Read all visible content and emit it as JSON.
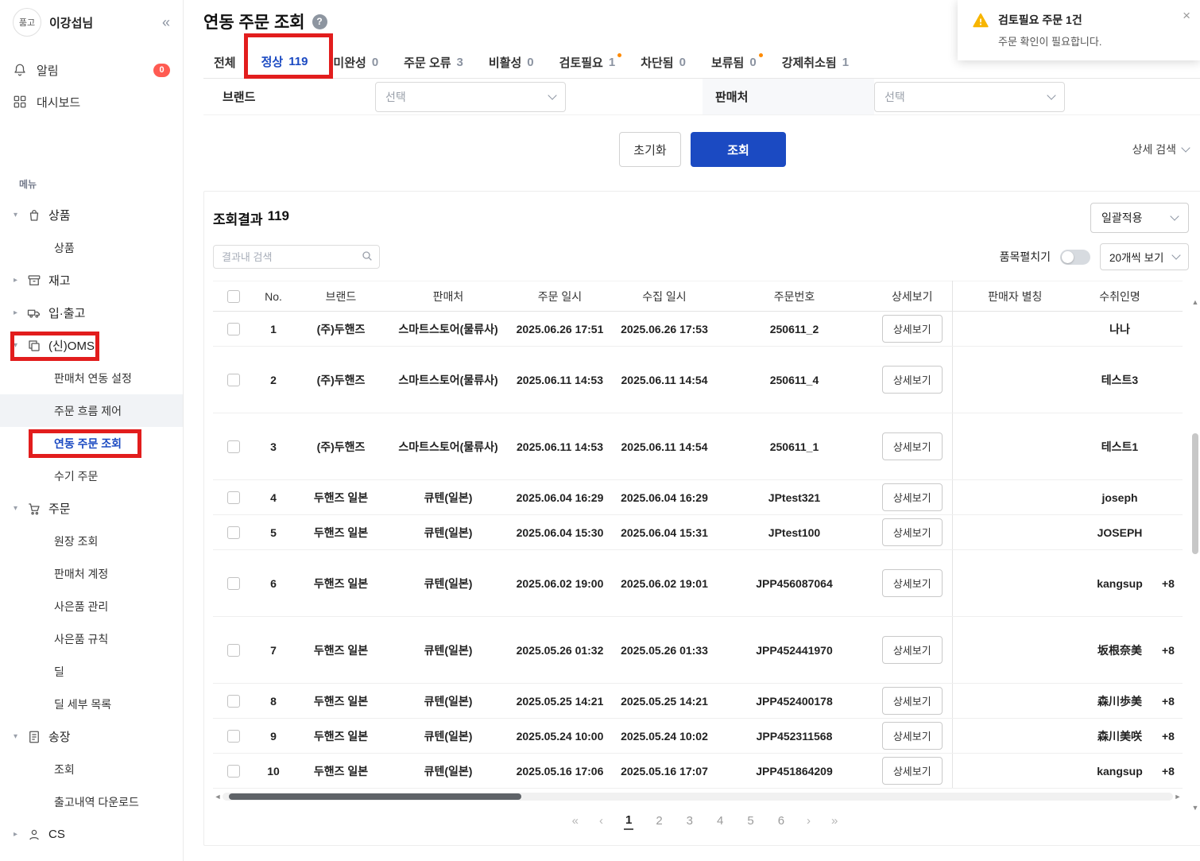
{
  "colors": {
    "accent_blue": "#1b4ac2",
    "annotation_red": "#e21d1d",
    "warning_yellow": "#f7b500",
    "badge_red": "#ff5b52",
    "dot_orange": "#ff8a00"
  },
  "sidebar": {
    "logo": "품고",
    "user_name": "이강섭님",
    "collapse": "«",
    "notifications": {
      "label": "알림",
      "badge": "0"
    },
    "dashboard": {
      "label": "대시보드"
    },
    "menu_heading": "메뉴",
    "groups": [
      {
        "label": "상품",
        "icon": "bag-icon",
        "expanded": true,
        "children": [
          {
            "label": "상품"
          }
        ]
      },
      {
        "label": "재고",
        "icon": "archive-icon",
        "expanded": false,
        "children": []
      },
      {
        "label": "입·출고",
        "icon": "truck-icon",
        "expanded": false,
        "children": []
      },
      {
        "label": "(신)OMS",
        "icon": "pages-icon",
        "expanded": true,
        "annotated": true,
        "children": [
          {
            "label": "판매처 연동 설정"
          },
          {
            "label": "주문 흐름 제어",
            "highlight": true
          },
          {
            "label": "연동 주문 조회",
            "active": true,
            "annotated": true
          },
          {
            "label": "수기 주문"
          }
        ]
      },
      {
        "label": "주문",
        "icon": "cart-icon",
        "expanded": true,
        "children": [
          {
            "label": "원장 조회"
          },
          {
            "label": "판매처 계정"
          },
          {
            "label": "사은품 관리"
          },
          {
            "label": "사은품 규칙"
          },
          {
            "label": "딜"
          },
          {
            "label": "딜 세부 목록"
          }
        ]
      },
      {
        "label": "송장",
        "icon": "invoice-icon",
        "expanded": true,
        "children": [
          {
            "label": "조회"
          },
          {
            "label": "출고내역 다운로드"
          }
        ]
      },
      {
        "label": "CS",
        "icon": "person-icon",
        "expanded": false,
        "children": []
      }
    ]
  },
  "header": {
    "title": "연동 주문 조회",
    "help": "?"
  },
  "tabs": [
    {
      "label": "전체",
      "count": "",
      "active": false
    },
    {
      "label": "정상",
      "count": "119",
      "active": true,
      "annotated": true
    },
    {
      "label": "미완성",
      "count": "0"
    },
    {
      "label": "주문 오류",
      "count": "3"
    },
    {
      "label": "비활성",
      "count": "0"
    },
    {
      "label": "검토필요",
      "count": "1",
      "dot": true
    },
    {
      "label": "차단됨",
      "count": "0"
    },
    {
      "label": "보류됨",
      "count": "0",
      "dot": true
    },
    {
      "label": "강제취소됨",
      "count": "1"
    }
  ],
  "filters": {
    "brand_label": "브랜드",
    "brand_value": "선택",
    "seller_label": "판매처",
    "seller_value": "선택",
    "reset_button": "초기화",
    "search_button": "조회",
    "advanced_search": "상세 검색"
  },
  "results": {
    "summary_label": "조회결과",
    "summary_count": "119",
    "bulk_apply": "일괄적용",
    "search_placeholder": "결과내 검색",
    "expand_items_label": "품목펼치기",
    "page_size": "20개씩 보기"
  },
  "table": {
    "columns": [
      "No.",
      "브랜드",
      "판매처",
      "주문 일시",
      "수집 일시",
      "주문번호",
      "상세보기",
      "판매자 별칭",
      "수취인명"
    ],
    "detail_button": "상세보기",
    "rows": [
      {
        "no": "1",
        "brand": "(주)두핸즈",
        "seller": "스마트스토어(물류사)",
        "order_date": "2025.06.26 17:51",
        "collect_date": "2025.06.26 17:53",
        "order_no": "250611_2",
        "alias": "",
        "recipient": "나나",
        "phone": "",
        "h": "sm"
      },
      {
        "no": "2",
        "brand": "(주)두핸즈",
        "seller": "스마트스토어(물류사)",
        "order_date": "2025.06.11 14:53",
        "collect_date": "2025.06.11 14:54",
        "order_no": "250611_4",
        "alias": "",
        "recipient": "테스트3",
        "phone": "",
        "h": "lg"
      },
      {
        "no": "3",
        "brand": "(주)두핸즈",
        "seller": "스마트스토어(물류사)",
        "order_date": "2025.06.11 14:53",
        "collect_date": "2025.06.11 14:54",
        "order_no": "250611_1",
        "alias": "",
        "recipient": "테스트1",
        "phone": "",
        "h": "lg"
      },
      {
        "no": "4",
        "brand": "두핸즈 일본",
        "seller": "큐텐(일본)",
        "order_date": "2025.06.04 16:29",
        "collect_date": "2025.06.04 16:29",
        "order_no": "JPtest321",
        "alias": "",
        "recipient": "joseph",
        "phone": "",
        "h": "sm"
      },
      {
        "no": "5",
        "brand": "두핸즈 일본",
        "seller": "큐텐(일본)",
        "order_date": "2025.06.04 15:30",
        "collect_date": "2025.06.04 15:31",
        "order_no": "JPtest100",
        "alias": "",
        "recipient": "JOSEPH",
        "phone": "",
        "h": "sm"
      },
      {
        "no": "6",
        "brand": "두핸즈 일본",
        "seller": "큐텐(일본)",
        "order_date": "2025.06.02 19:00",
        "collect_date": "2025.06.02 19:01",
        "order_no": "JPP456087064",
        "alias": "",
        "recipient": "kangsup",
        "phone": "+8",
        "h": "lg"
      },
      {
        "no": "7",
        "brand": "두핸즈 일본",
        "seller": "큐텐(일본)",
        "order_date": "2025.05.26 01:32",
        "collect_date": "2025.05.26 01:33",
        "order_no": "JPP452441970",
        "alias": "",
        "recipient": "坂根奈美",
        "phone": "+8",
        "h": "lg"
      },
      {
        "no": "8",
        "brand": "두핸즈 일본",
        "seller": "큐텐(일본)",
        "order_date": "2025.05.25 14:21",
        "collect_date": "2025.05.25 14:21",
        "order_no": "JPP452400178",
        "alias": "",
        "recipient": "森川歩美",
        "phone": "+8",
        "h": "sm"
      },
      {
        "no": "9",
        "brand": "두핸즈 일본",
        "seller": "큐텐(일본)",
        "order_date": "2025.05.24 10:00",
        "collect_date": "2025.05.24 10:02",
        "order_no": "JPP452311568",
        "alias": "",
        "recipient": "森川美咲",
        "phone": "+8",
        "h": "sm"
      },
      {
        "no": "10",
        "brand": "두핸즈 일본",
        "seller": "큐텐(일본)",
        "order_date": "2025.05.16 17:06",
        "collect_date": "2025.05.16 17:07",
        "order_no": "JPP451864209",
        "alias": "",
        "recipient": "kangsup",
        "phone": "+8",
        "h": "sm"
      }
    ]
  },
  "pagination": {
    "first": "«",
    "prev": "‹",
    "pages": [
      "1",
      "2",
      "3",
      "4",
      "5",
      "6"
    ],
    "current": "1",
    "next": "›",
    "last": "»"
  },
  "toast": {
    "title": "검토필요 주문 1건",
    "message": "주문 확인이 필요합니다.",
    "close": "×"
  }
}
